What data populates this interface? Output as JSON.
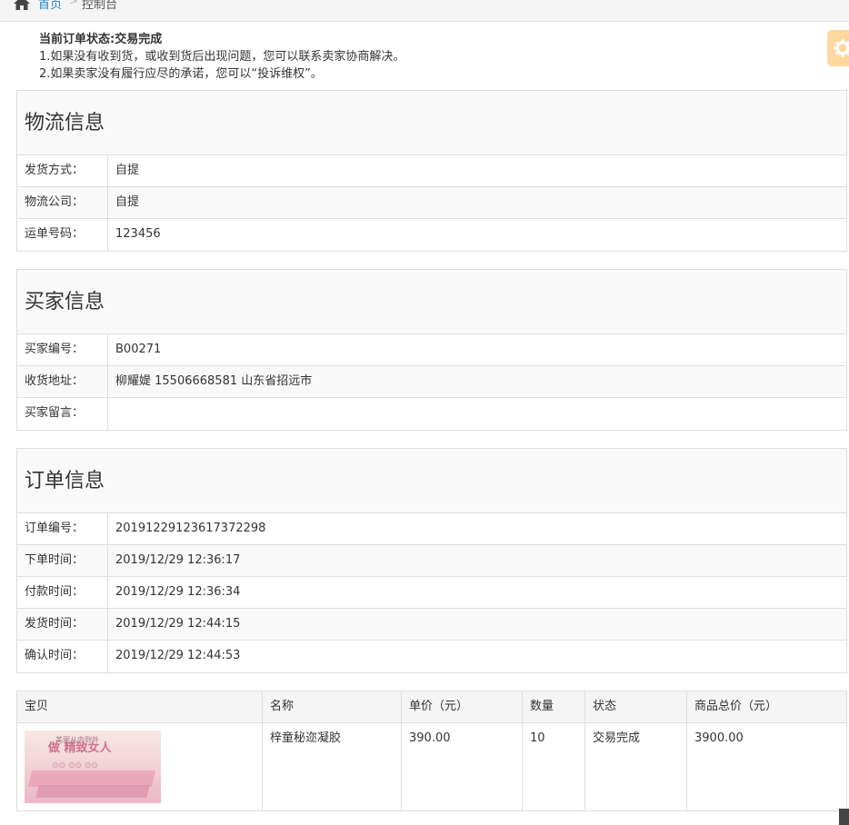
{
  "breadcrumb": {
    "home": "首页",
    "separator": ">",
    "current": "控制台"
  },
  "notice": {
    "status": "当前订单状态:交易完成",
    "line1": "1.如果没有收到货，或收到货后出现问题，您可以联系卖家协商解决。",
    "line2": "2.如果卖家没有履行应尽的承诺，您可以“投诉维权”。"
  },
  "logistics": {
    "title": "物流信息",
    "rows": [
      {
        "label": "发货方式：",
        "value": "自提"
      },
      {
        "label": "物流公司：",
        "value": "自提"
      },
      {
        "label": "运单号码：",
        "value": "123456"
      }
    ]
  },
  "buyer": {
    "title": "买家信息",
    "rows": [
      {
        "label": "买家编号：",
        "value": "B00271"
      },
      {
        "label": "收货地址：",
        "value": "柳耀媞 15506668581 山东省招远市"
      },
      {
        "label": "买家留言：",
        "value": ""
      }
    ]
  },
  "order": {
    "title": "订单信息",
    "rows": [
      {
        "label": "订单编号：",
        "value": "20191229123617372298"
      },
      {
        "label": "下单时间：",
        "value": "2019/12/29 12:36:17"
      },
      {
        "label": "付款时间：",
        "value": "2019/12/29 12:36:34"
      },
      {
        "label": "发货时间：",
        "value": "2019/12/29 12:44:15"
      },
      {
        "label": "确认时间：",
        "value": "2019/12/29 12:44:53"
      }
    ]
  },
  "goods": {
    "headers": [
      "宝贝",
      "名称",
      "单价（元）",
      "数量",
      "状态",
      "商品总价（元）"
    ],
    "items": [
      {
        "name": "梓童秘迩凝胶",
        "price": "390.00",
        "qty": "10",
        "status": "交易完成",
        "total": "3900.00",
        "image_text_top": "美丽从内到外",
        "image_text_main": "做 精致女人",
        "image_dots": "⊙⊙ ⊙⊙ ⊙⊙"
      }
    ]
  },
  "colors": {
    "link": "#2283c5",
    "settings": "#ffb752",
    "border": "#dddddd"
  }
}
